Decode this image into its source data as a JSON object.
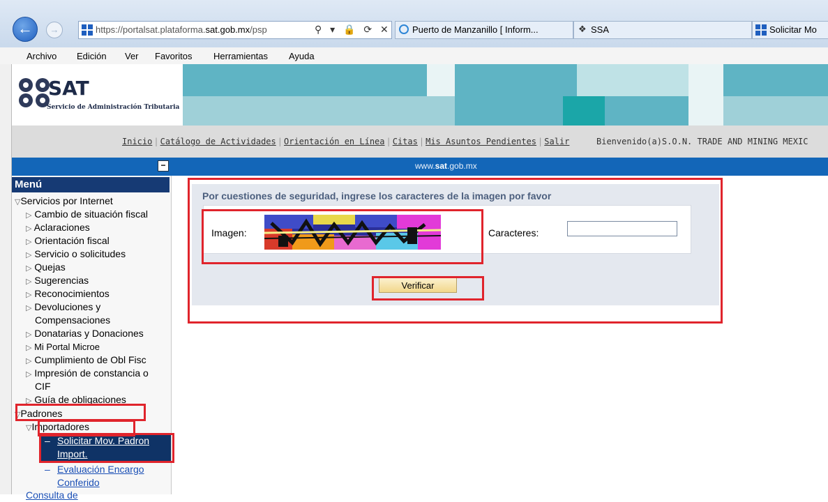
{
  "browser": {
    "url_prefix": "https://portalsat.plataforma.",
    "url_domain": "sat.gob.mx",
    "url_suffix": "/psp",
    "address_tools": "⚲ ▾ 🔒 ⟳ ✕",
    "tabs": [
      {
        "label": "Puerto de Manzanillo [ Inform...",
        "icon": "ie-icon"
      },
      {
        "label": "SSA",
        "icon": "globe-icon"
      },
      {
        "label": "Solicitar Mo",
        "icon": "sat-favicon-icon"
      }
    ],
    "menu": [
      "Archivo",
      "Edición",
      "Ver",
      "Favoritos",
      "Herramientas",
      "Ayuda"
    ]
  },
  "header": {
    "logo_text": "SAT",
    "logo_subtitle": "Servicio de Administración Tributaria"
  },
  "top_links": [
    "Inicio",
    "Catálogo de Actividades",
    "Orientación en Línea",
    "Citas",
    "Mis Asuntos Pendientes",
    "Salir"
  ],
  "welcome_text": "Bienvenido(a)S.O.N. TRADE AND MINING MEXIC",
  "site_url": {
    "pre": "www.",
    "bold": "sat",
    "post": ".gob.mx"
  },
  "collapse_symbol": "−",
  "sidebar": {
    "title": "Menú",
    "section": "Servicios por Internet",
    "items": [
      "Cambio de situación fiscal",
      "Aclaraciones",
      "Orientación fiscal",
      "Servicio o solicitudes",
      "Quejas",
      "Sugerencias",
      "Reconocimientos",
      "Devoluciones y",
      "Compensaciones",
      "Donatarias y Donaciones",
      "Mi Portal Microe",
      "Cumplimiento de Obl Fisc",
      "Impresión de constancia o",
      "CIF",
      "Guía de obligaciones"
    ],
    "padrones": "Padrones",
    "importadores": "Importadores",
    "selected_line1": "Solicitar Mov. Padron",
    "selected_line2": "Import.",
    "eval_line1": "Evaluación Encargo",
    "eval_line2": "Conferido",
    "cut_off": "Consulta de"
  },
  "main": {
    "title": "Por cuestiones de seguridad, ingrese los caracteres de la imagen por favor",
    "image_label": "Imagen:",
    "chars_label": "Caracteres:",
    "chars_value": "",
    "verify_button": "Verificar"
  },
  "colors": {
    "blue_bar": "#1366b8",
    "menu_head": "#163a74",
    "highlight_red": "#e0242c",
    "button": "#f2d78b"
  }
}
